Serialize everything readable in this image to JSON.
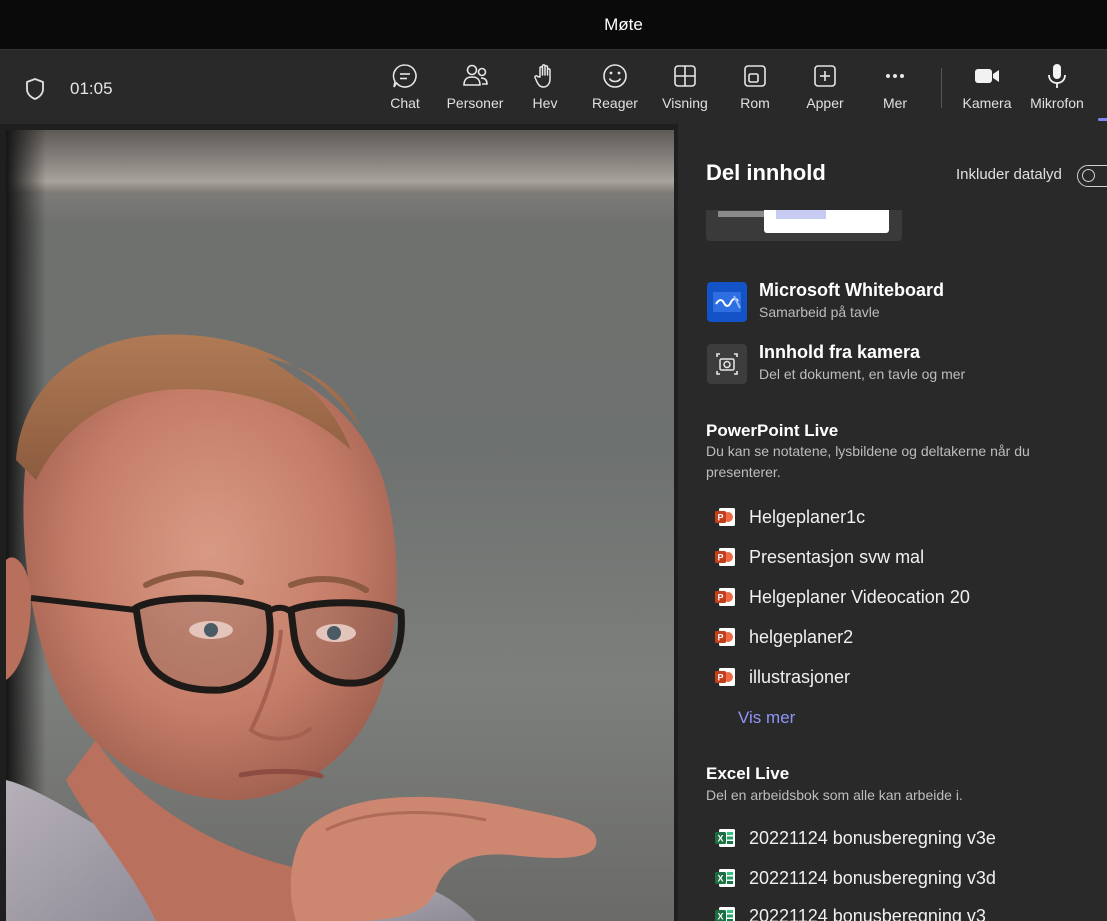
{
  "window": {
    "title": "Møte"
  },
  "meeting": {
    "timer": "01:05"
  },
  "toolbar": {
    "buttons": [
      {
        "label": "Chat",
        "icon": "chat-icon"
      },
      {
        "label": "Personer",
        "icon": "people-icon"
      },
      {
        "label": "Hev",
        "icon": "raise-hand-icon"
      },
      {
        "label": "Reager",
        "icon": "emoji-icon"
      },
      {
        "label": "Visning",
        "icon": "grid-view-icon"
      },
      {
        "label": "Rom",
        "icon": "rooms-icon"
      },
      {
        "label": "Apper",
        "icon": "add-app-icon"
      },
      {
        "label": "Mer",
        "icon": "more-icon"
      },
      {
        "label": "Kamera",
        "icon": "camera-icon"
      },
      {
        "label": "Mikrofon",
        "icon": "microphone-icon"
      }
    ]
  },
  "share_panel": {
    "title": "Del innhold",
    "include_sound_label": "Inkluder datalyd",
    "include_sound_on": false,
    "options": [
      {
        "name": "Microsoft Whiteboard",
        "sub": "Samarbeid på tavle",
        "icon": "whiteboard-icon"
      },
      {
        "name": "Innhold fra kamera",
        "sub": "Del et dokument, en tavle og mer",
        "icon": "camera-content-icon"
      }
    ],
    "powerpoint": {
      "title": "PowerPoint Live",
      "description": "Du kan se notatene, lysbildene og deltakerne når du presenterer.",
      "files": [
        {
          "name": "Helgeplaner1c",
          "icon": "powerpoint-file-icon"
        },
        {
          "name": "Presentasjon svw mal",
          "icon": "powerpoint-file-icon"
        },
        {
          "name": "Helgeplaner Videocation 20",
          "icon": "powerpoint-file-icon"
        },
        {
          "name": "helgeplaner2",
          "icon": "powerpoint-file-icon"
        },
        {
          "name": "illustrasjoner",
          "icon": "powerpoint-file-icon"
        }
      ],
      "more_label": "Vis mer"
    },
    "excel": {
      "title": "Excel Live",
      "description": "Del en arbeidsbok som alle kan arbeide i.",
      "files": [
        {
          "name": "20221124 bonusberegning v3e",
          "icon": "excel-file-icon"
        },
        {
          "name": "20221124 bonusberegning v3d",
          "icon": "excel-file-icon"
        },
        {
          "name": "20221124 bonusberegning v3",
          "icon": "excel-file-icon"
        }
      ]
    }
  },
  "colors": {
    "accent": "#7f85f5",
    "link": "#8f95f7",
    "panel_bg": "#292929",
    "titlebar_bg": "#0a0a0a",
    "powerpoint_red": "#c43e1c",
    "excel_green": "#1d6f42",
    "whiteboard_blue": "#1452c7"
  }
}
